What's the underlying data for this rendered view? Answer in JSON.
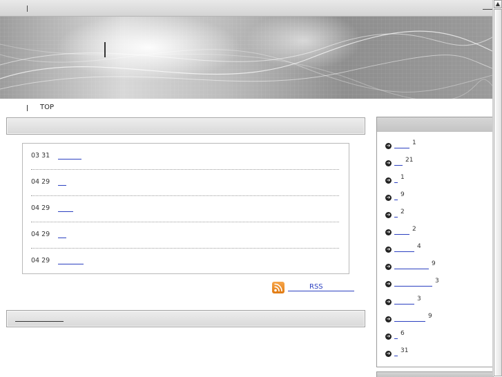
{
  "breadcrumb": {
    "top_label": "TOP"
  },
  "news": [
    {
      "date": "03 31"
    },
    {
      "date": "04 29"
    },
    {
      "date": "04 29"
    },
    {
      "date": "04 29"
    },
    {
      "date": "04 29"
    }
  ],
  "rss": {
    "label": "RSS"
  },
  "categories": [
    {
      "count": "1"
    },
    {
      "count": "21"
    },
    {
      "count": "1"
    },
    {
      "count": "9"
    },
    {
      "count": "2"
    },
    {
      "count": "2"
    },
    {
      "count": "4"
    },
    {
      "count": "9"
    },
    {
      "count": "3"
    },
    {
      "count": "3"
    },
    {
      "count": "9"
    },
    {
      "count": "6"
    },
    {
      "count": "31"
    }
  ],
  "icons": {
    "bullet": "arrow-circle-right-icon",
    "rss": "rss-feed-icon",
    "scroll_up": "scroll-up-arrow-icon"
  },
  "colors": {
    "link": "#2a3fc0",
    "section_bar": "#dcdcdc",
    "rss_orange": "#f08a1c"
  }
}
